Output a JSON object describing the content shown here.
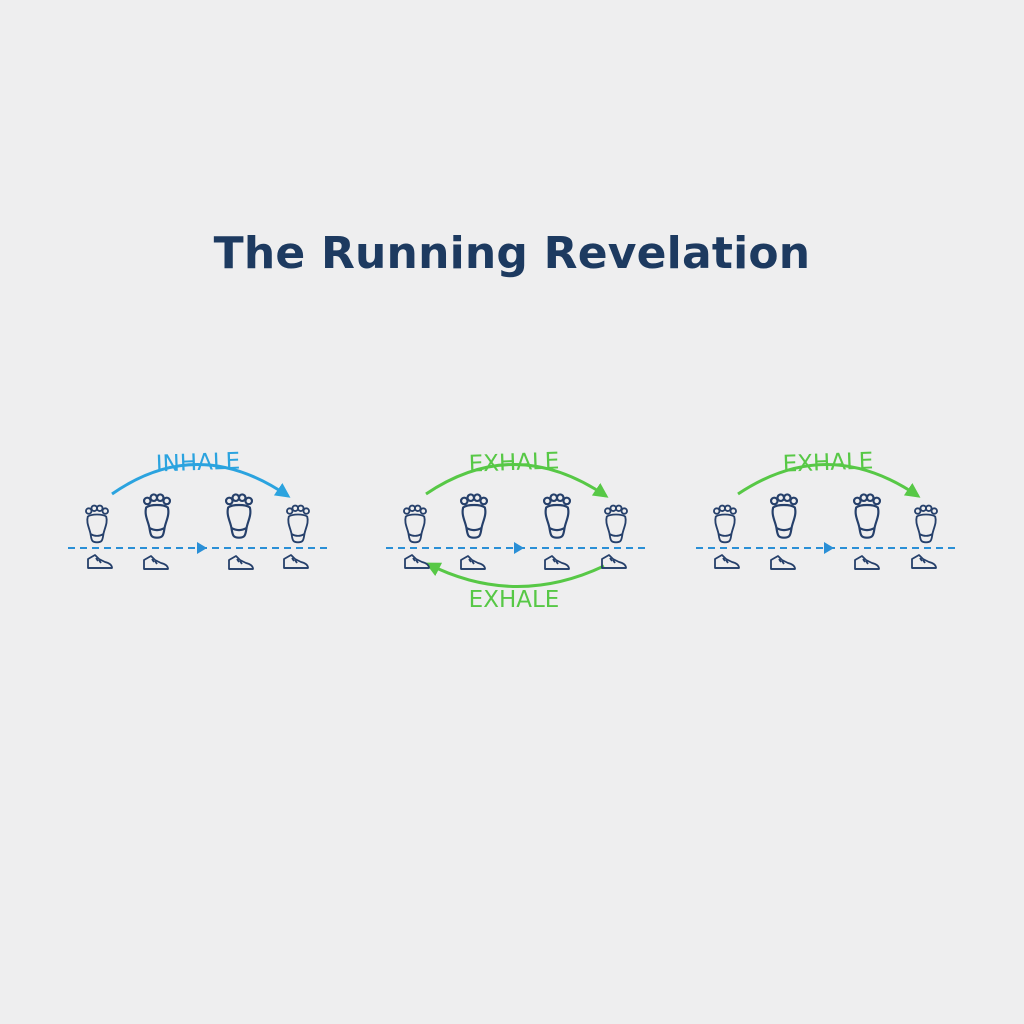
{
  "title": "The Running Revelation",
  "colors": {
    "title": "#1d3a60",
    "inhale": "#2ba3df",
    "exhale": "#57c846",
    "footprint": "#26406b",
    "ground_line": "#2a8fd6",
    "background": "#eeeeef"
  },
  "panels": [
    {
      "top_label": "INHALE",
      "top_color": "#2ba3df",
      "bottom_label": "",
      "bottom_color": ""
    },
    {
      "top_label": "EXHALE",
      "top_color": "#57c846",
      "bottom_label": "EXHALE",
      "bottom_color": "#57c846"
    },
    {
      "top_label": "EXHALE",
      "top_color": "#57c846",
      "bottom_label": "",
      "bottom_color": ""
    }
  ],
  "icons": {
    "footprint": "footprint-icon",
    "shoe": "running-shoe-icon",
    "direction": "arrow-right-icon"
  }
}
